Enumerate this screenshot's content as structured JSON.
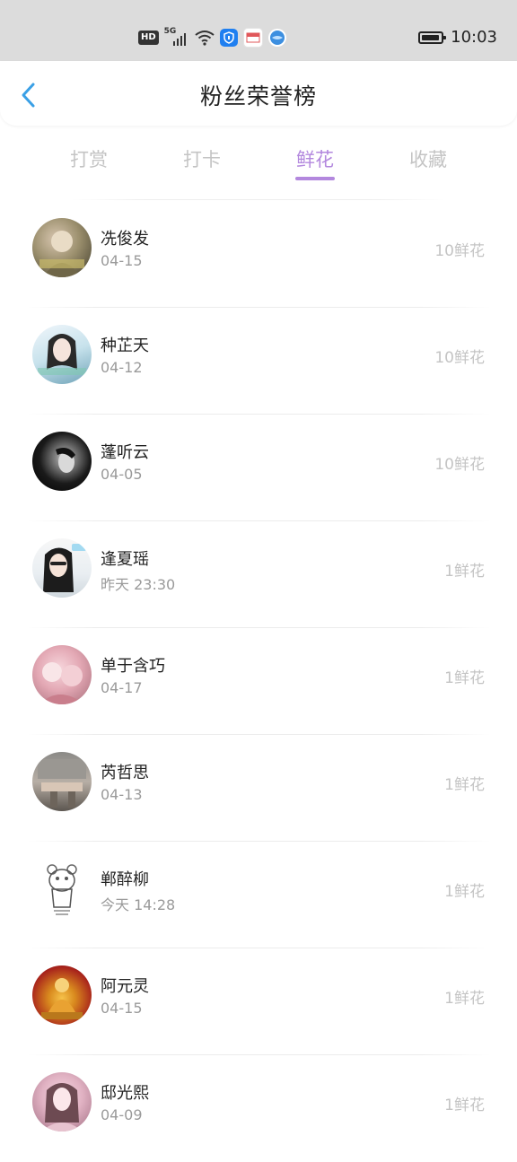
{
  "status_bar": {
    "hd_label": "HD",
    "network_label": "5G",
    "time": "10:03",
    "icons": [
      "hd-icon",
      "signal-5g-icon",
      "wifi-icon",
      "shield-app-icon",
      "mail-app-icon",
      "globe-app-icon",
      "battery-icon"
    ]
  },
  "header": {
    "title": "粉丝荣誉榜",
    "back_icon": "chevron-left-icon"
  },
  "tabs": [
    {
      "label": "打赏",
      "active": false
    },
    {
      "label": "打卡",
      "active": false
    },
    {
      "label": "鲜花",
      "active": true
    },
    {
      "label": "收藏",
      "active": false
    }
  ],
  "colors": {
    "accent": "#b388de",
    "back_arrow": "#3aa0e6",
    "inactive_tab": "#c4c4c4",
    "amount": "#c4c4c4",
    "date": "#9a9a9a"
  },
  "fans": [
    {
      "name": "冼俊发",
      "date": "04-15",
      "amount": "10鲜花"
    },
    {
      "name": "种芷天",
      "date": "04-12",
      "amount": "10鲜花"
    },
    {
      "name": "蓬听云",
      "date": "04-05",
      "amount": "10鲜花"
    },
    {
      "name": "逢夏瑶",
      "date": "昨天 23:30",
      "amount": "1鲜花"
    },
    {
      "name": "单于含巧",
      "date": "04-17",
      "amount": "1鲜花"
    },
    {
      "name": "芮哲思",
      "date": "04-13",
      "amount": "1鲜花"
    },
    {
      "name": "郸醉柳",
      "date": "今天 14:28",
      "amount": "1鲜花"
    },
    {
      "name": "阿元灵",
      "date": "04-15",
      "amount": "1鲜花"
    },
    {
      "name": "邸光熙",
      "date": "04-09",
      "amount": "1鲜花"
    }
  ]
}
